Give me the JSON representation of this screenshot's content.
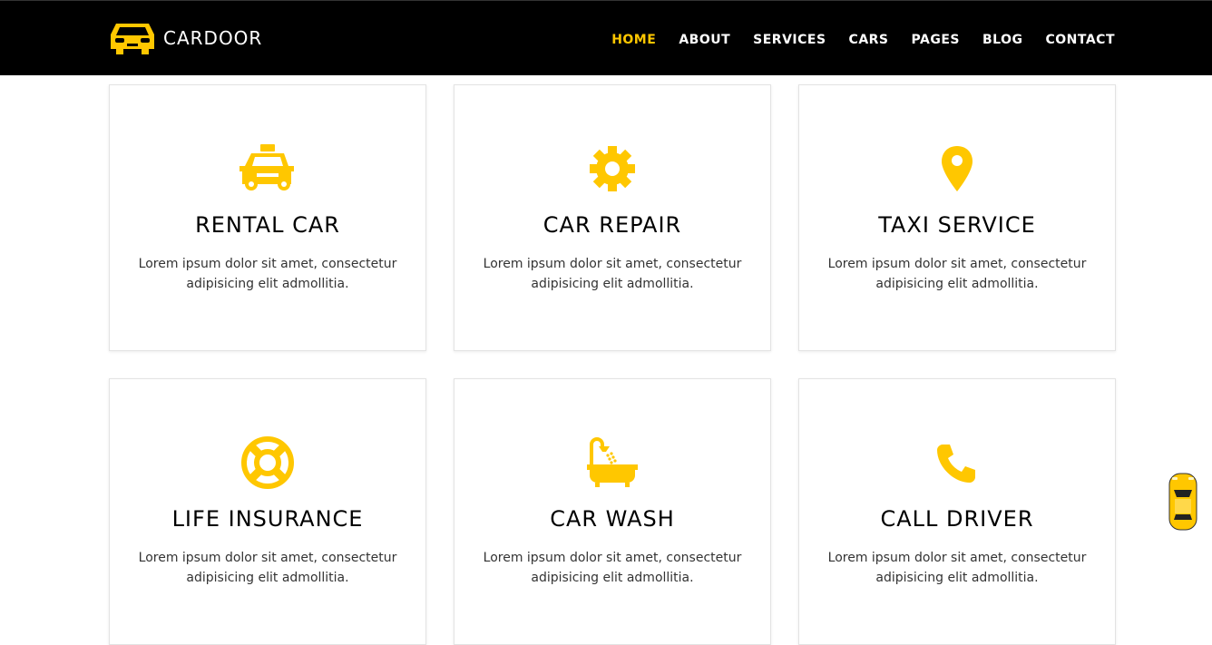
{
  "brand": {
    "name": "CARDOOR",
    "logo_icon": "car-front-icon",
    "accent_color": "#ffc700"
  },
  "nav": {
    "items": [
      {
        "label": "HOME",
        "active": true
      },
      {
        "label": "ABOUT",
        "active": false
      },
      {
        "label": "SERVICES",
        "active": false
      },
      {
        "label": "CARS",
        "active": false
      },
      {
        "label": "PAGES",
        "active": false
      },
      {
        "label": "BLOG",
        "active": false
      },
      {
        "label": "CONTACT",
        "active": false
      }
    ]
  },
  "services": [
    {
      "title": "RENTAL CAR",
      "icon": "taxi-icon",
      "text": "Lorem ipsum dolor sit amet, consectetur adipisicing elit admollitia."
    },
    {
      "title": "CAR REPAIR",
      "icon": "gear-icon",
      "text": "Lorem ipsum dolor sit amet, consectetur adipisicing elit admollitia."
    },
    {
      "title": "TAXI SERVICE",
      "icon": "map-pin-icon",
      "text": "Lorem ipsum dolor sit amet, consectetur adipisicing elit admollitia."
    },
    {
      "title": "LIFE INSURANCE",
      "icon": "life-ring-icon",
      "text": "Lorem ipsum dolor sit amet, consectetur adipisicing elit admollitia."
    },
    {
      "title": "CAR WASH",
      "icon": "bathtub-icon",
      "text": "Lorem ipsum dolor sit amet, consectetur adipisicing elit admollitia."
    },
    {
      "title": "CALL DRIVER",
      "icon": "phone-icon",
      "text": "Lorem ipsum dolor sit amet, consectetur adipisicing elit admollitia."
    }
  ],
  "floating_widget": {
    "icon": "car-top-view-icon"
  }
}
